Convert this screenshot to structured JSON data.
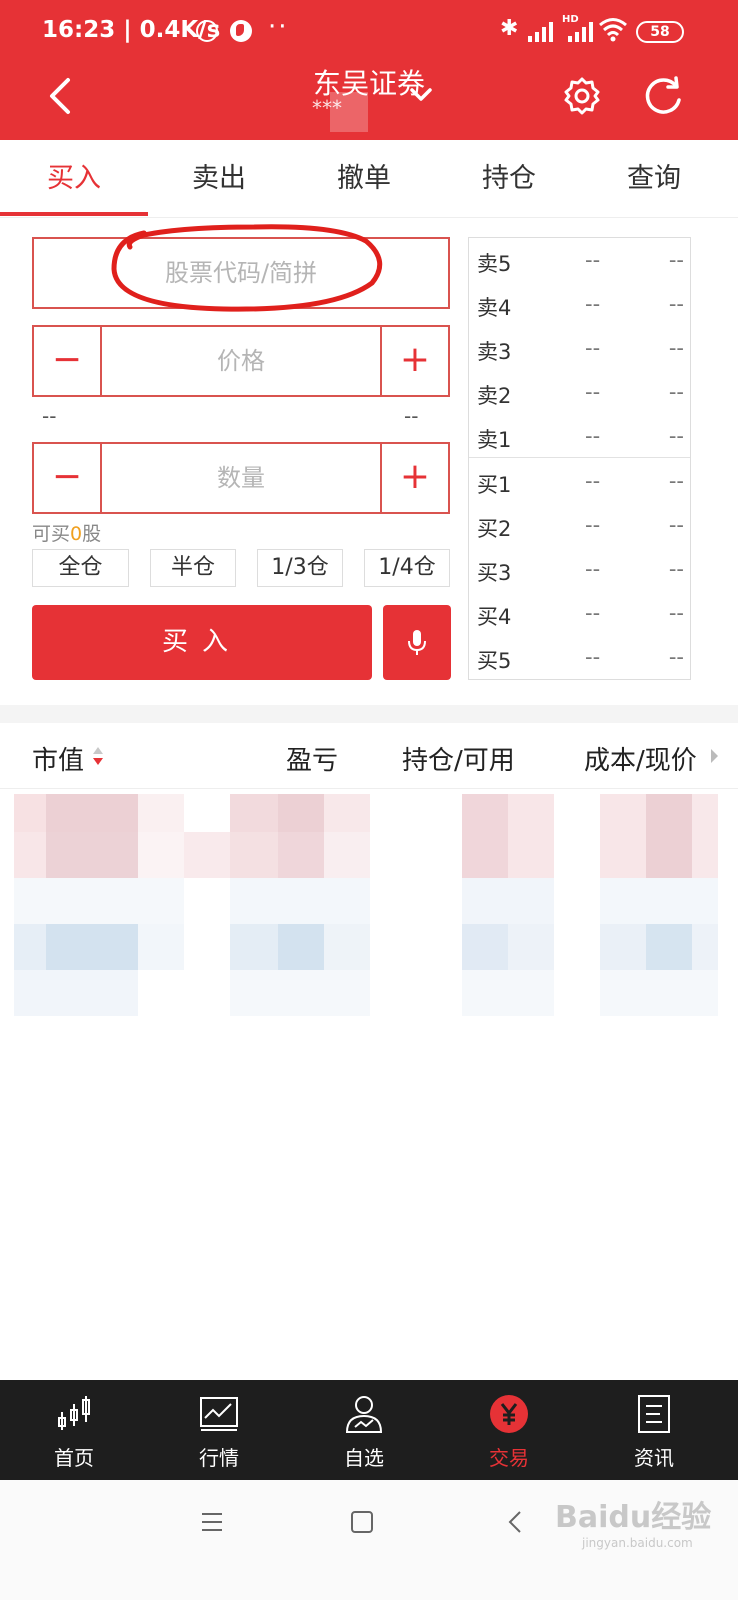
{
  "status_bar": {
    "time_speed": "16:23 | 0.4K/s",
    "dots": "··",
    "hd": "HD",
    "battery": "58"
  },
  "header": {
    "title": "东吴证券",
    "account_masked": "***"
  },
  "tabs": [
    "买入",
    "卖出",
    "撤单",
    "持仓",
    "查询"
  ],
  "form": {
    "code_placeholder": "股票代码/简拼",
    "price_placeholder": "价格",
    "qty_placeholder": "数量",
    "minus": "−",
    "plus": "+",
    "limit_low": "--",
    "limit_high": "--",
    "buyable_prefix": "可买",
    "buyable_count": "0",
    "buyable_suffix": "股",
    "position_buttons": [
      "全仓",
      "半仓",
      "1/3仓",
      "1/4仓"
    ],
    "buy_label": "买入"
  },
  "orderbook": {
    "rows": [
      {
        "label": "卖5",
        "price": "--",
        "volume": "--"
      },
      {
        "label": "卖4",
        "price": "--",
        "volume": "--"
      },
      {
        "label": "卖3",
        "price": "--",
        "volume": "--"
      },
      {
        "label": "卖2",
        "price": "--",
        "volume": "--"
      },
      {
        "label": "卖1",
        "price": "--",
        "volume": "--"
      },
      {
        "label": "买1",
        "price": "--",
        "volume": "--"
      },
      {
        "label": "买2",
        "price": "--",
        "volume": "--"
      },
      {
        "label": "买3",
        "price": "--",
        "volume": "--"
      },
      {
        "label": "买4",
        "price": "--",
        "volume": "--"
      },
      {
        "label": "买5",
        "price": "--",
        "volume": "--"
      }
    ]
  },
  "holdings": {
    "columns": [
      "市值",
      "盈亏",
      "持仓/可用",
      "成本/现价"
    ]
  },
  "bottom_nav": [
    {
      "label": "首页",
      "icon": "candlestick-icon"
    },
    {
      "label": "行情",
      "icon": "chart-icon"
    },
    {
      "label": "自选",
      "icon": "user-chart-icon"
    },
    {
      "label": "交易",
      "icon": "yen-icon",
      "active": true
    },
    {
      "label": "资讯",
      "icon": "document-icon"
    }
  ],
  "watermark": {
    "text": "Baidu经验",
    "sub": "jingyan.baidu.com"
  },
  "colors": {
    "brand_red": "#e63236",
    "accent_orange": "#f0a020",
    "nav_bg": "#1e1e1e"
  }
}
